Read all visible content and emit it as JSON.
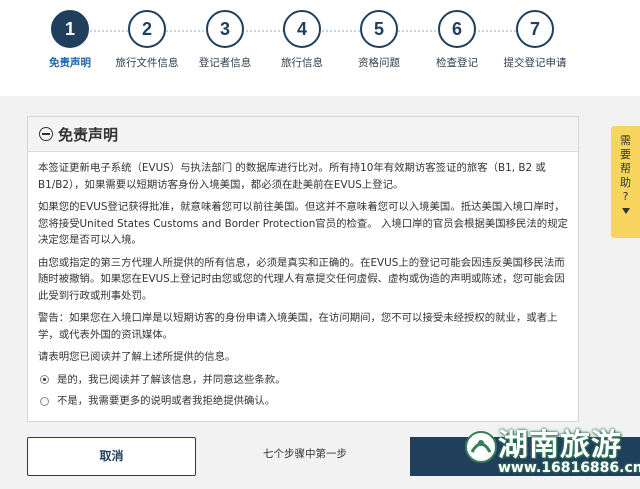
{
  "steps": [
    {
      "num": "1",
      "label": "免责声明",
      "active": true
    },
    {
      "num": "2",
      "label": "旅行文件信息",
      "active": false
    },
    {
      "num": "3",
      "label": "登记者信息",
      "active": false
    },
    {
      "num": "4",
      "label": "旅行信息",
      "active": false
    },
    {
      "num": "5",
      "label": "资格问题",
      "active": false
    },
    {
      "num": "6",
      "label": "检查登记",
      "active": false
    },
    {
      "num": "7",
      "label": "提交登记申请",
      "active": false
    }
  ],
  "panel": {
    "title": "免责声明",
    "paragraphs": [
      "本签证更新电子系统（EVUS）与执法部门 的数据库进行比对。所有持10年有效期访客签证的旅客（B1, B2 或 B1/B2），如果需要以短期访客身份入境美国，都必须在赴美前在EVUS上登记。",
      "如果您的EVUS登记获得批准，就意味着您可以前往美国。但这并不意味着您可以入境美国。抵达美国入境口岸时，您将接受United States Customs and Border Protection官员的检查。 入境口岸的官员会根据美国移民法的规定决定您是否可以入境。",
      "由您或指定的第三方代理人所提供的所有信息，必须是真实和正确的。在EVUS上的登记可能会因违反美国移民法而随时被撤销。如果您在EVUS上登记时由您或您的代理人有意提交任何虚假、虚构或伪造的声明或陈述，您可能会因此受到行政或刑事处罚。",
      "警告：如果您在入境口岸是以短期访客的身份申请入境美国，在访问期间，您不可以接受未经授权的就业，或者上学，或代表外国的资讯媒体。",
      "请表明您已阅读并了解上述所提供的信息。"
    ],
    "options": [
      {
        "label": "是的，我已阅读并了解该信息，并同意这些条款。",
        "checked": true
      },
      {
        "label": "不是，我需要更多的说明或者我拒绝提供确认。",
        "checked": false
      }
    ]
  },
  "footer": {
    "cancel_label": "取消",
    "step_count": "七个步骤中第一步"
  },
  "help_tab": {
    "chars": [
      "需",
      "要",
      "帮",
      "助",
      "?"
    ]
  },
  "watermark": {
    "brand": "湖南旅游",
    "url": "www.16816886.cn"
  },
  "colors": {
    "primary": "#1f3f5c",
    "active_label": "#1f66a8",
    "help_tab": "#f7d55e",
    "band": "#f2f2f2"
  }
}
